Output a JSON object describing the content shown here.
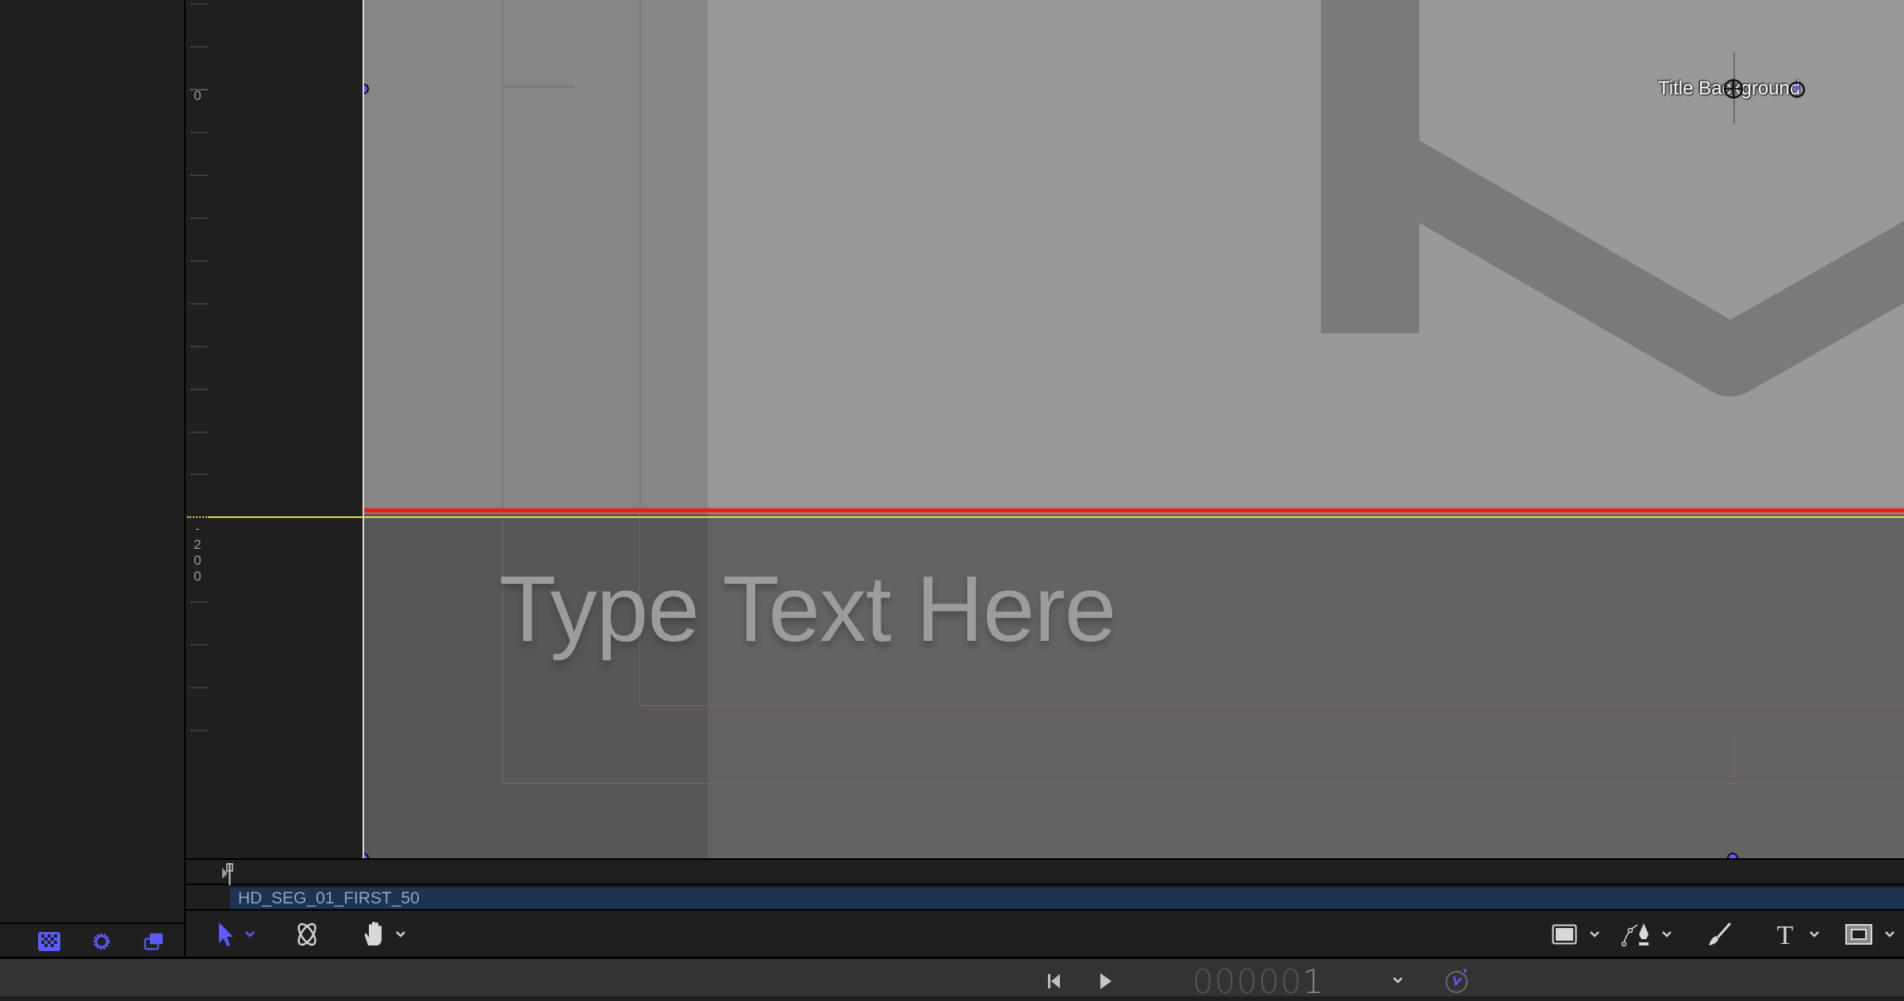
{
  "ruler": {
    "labels": [
      {
        "text": "0"
      },
      {
        "text": "-200"
      }
    ]
  },
  "canvas": {
    "placeholder_text": "Type Text Here",
    "selected_layer_label": "Title Background"
  },
  "timeline": {
    "clip_name": "HD_SEG_01_FIRST_50"
  },
  "left_panel": {
    "icons": [
      "transparency-checker-icon",
      "settings-gear-icon",
      "layers-overlay-icon"
    ]
  },
  "toolbar": {
    "left_tools": [
      "select-transform-tool",
      "3d-transform-tool",
      "pan-hand-tool"
    ],
    "right_tools": [
      "shape-rectangle-tool",
      "bezier-pen-tool",
      "paint-brush-tool",
      "text-tool",
      "mask-tool"
    ]
  },
  "transport": {
    "timecode_leading": "00000",
    "timecode_last": "1",
    "buttons": [
      "go-to-start",
      "play"
    ]
  },
  "colors": {
    "accent": "#5b5bff",
    "clip_bar": "#1e3252",
    "guide_red": "#e42020",
    "guide_yellow": "#e8e040"
  }
}
